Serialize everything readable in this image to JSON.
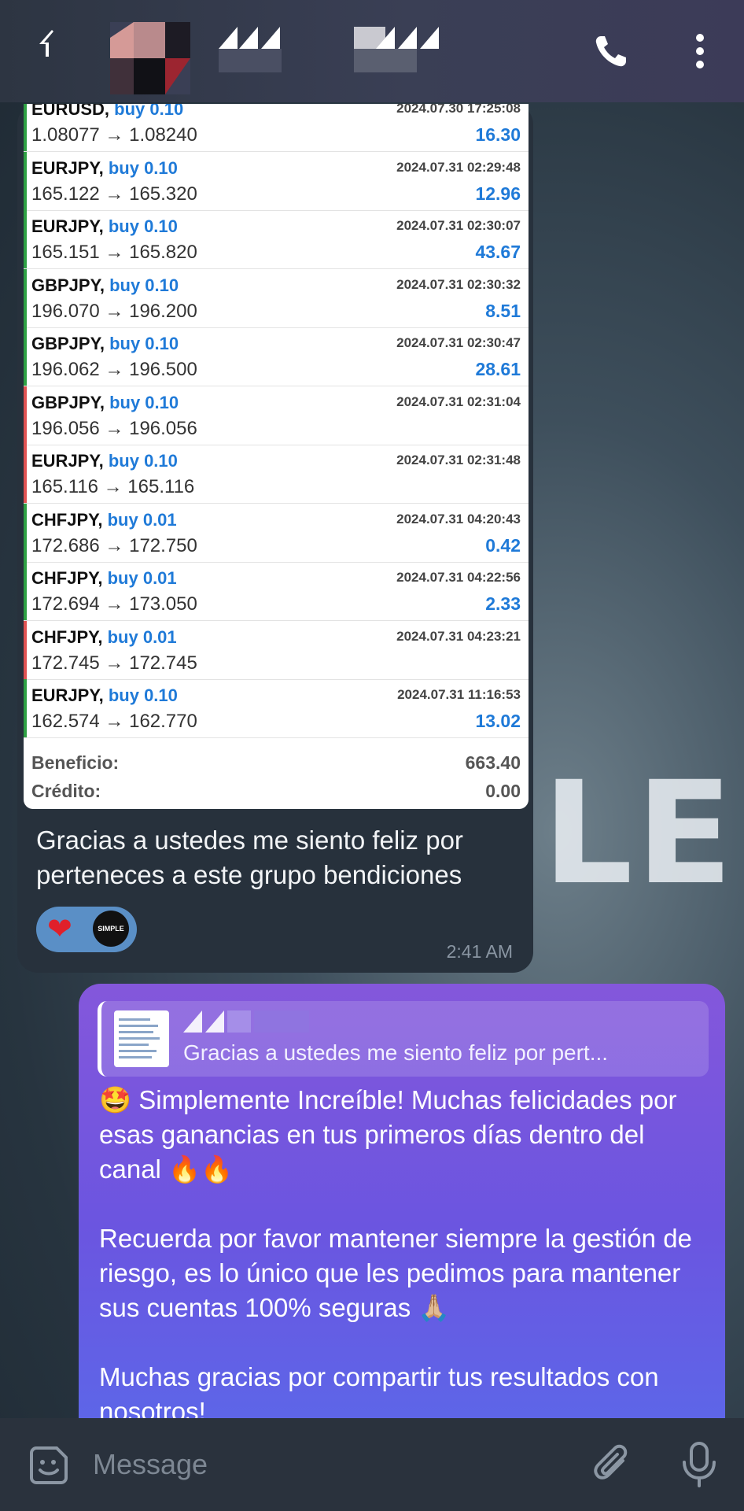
{
  "trades": [
    {
      "symbol": "EURUSD,",
      "side": "buy 0.10",
      "date": "2024.07.30 17:25:08",
      "prices": "1.08077 → 1.08240",
      "pl": "16.30",
      "color": "#2ea043"
    },
    {
      "symbol": "EURJPY,",
      "side": "buy 0.10",
      "date": "2024.07.31 02:29:48",
      "prices": "165.122 → 165.320",
      "pl": "12.96",
      "color": "#2ea043"
    },
    {
      "symbol": "EURJPY,",
      "side": "buy 0.10",
      "date": "2024.07.31 02:30:07",
      "prices": "165.151 → 165.820",
      "pl": "43.67",
      "color": "#2ea043"
    },
    {
      "symbol": "GBPJPY,",
      "side": "buy 0.10",
      "date": "2024.07.31 02:30:32",
      "prices": "196.070 → 196.200",
      "pl": "8.51",
      "color": "#2ea043"
    },
    {
      "symbol": "GBPJPY,",
      "side": "buy 0.10",
      "date": "2024.07.31 02:30:47",
      "prices": "196.062 → 196.500",
      "pl": "28.61",
      "color": "#2ea043"
    },
    {
      "symbol": "GBPJPY,",
      "side": "buy 0.10",
      "date": "2024.07.31 02:31:04",
      "prices": "196.056 → 196.056",
      "pl": "",
      "color": "#e05252"
    },
    {
      "symbol": "EURJPY,",
      "side": "buy 0.10",
      "date": "2024.07.31 02:31:48",
      "prices": "165.116 → 165.116",
      "pl": "",
      "color": "#e05252"
    },
    {
      "symbol": "CHFJPY,",
      "side": "buy 0.01",
      "date": "2024.07.31 04:20:43",
      "prices": "172.686 → 172.750",
      "pl": "0.42",
      "color": "#2ea043"
    },
    {
      "symbol": "CHFJPY,",
      "side": "buy 0.01",
      "date": "2024.07.31 04:22:56",
      "prices": "172.694 → 173.050",
      "pl": "2.33",
      "color": "#2ea043"
    },
    {
      "symbol": "CHFJPY,",
      "side": "buy 0.01",
      "date": "2024.07.31 04:23:21",
      "prices": "172.745 → 172.745",
      "pl": "",
      "color": "#e05252"
    },
    {
      "symbol": "EURJPY,",
      "side": "buy 0.10",
      "date": "2024.07.31 11:16:53",
      "prices": "162.574 → 162.770",
      "pl": "13.02",
      "color": "#2ea043"
    }
  ],
  "summary": {
    "profit_label": "Beneficio:",
    "profit_value": "663.40",
    "credit_label": "Crédito:",
    "credit_value": "0.00"
  },
  "incoming": {
    "text": "Gracias a ustedes me siento feliz por perteneces a este grupo bendiciones",
    "reaction_emoji": "❤",
    "reaction_avatar": "SIMPLE",
    "time": "2:41 AM"
  },
  "background_text": "LE",
  "outgoing": {
    "reply_text": "Gracias a ustedes me siento feliz por pert...",
    "paragraphs": [
      "🤩 Simplemente Increíble! Muchas felicidades por esas ganancias en tus primeros días dentro del canal 🔥🔥",
      "Recuerda por favor mantener siempre la gestión de riesgo, es lo único que les pedimos para mantener sus cuentas 100% seguras 🙏🏼",
      "Muchas gracias por compartir tus resultados con nosotros!"
    ]
  },
  "input": {
    "placeholder": "Message"
  },
  "icons": {
    "back": "back-arrow-icon",
    "call": "phone-icon",
    "more": "more-vertical-icon",
    "sticker": "sticker-icon",
    "attach": "paperclip-icon",
    "mic": "microphone-icon"
  }
}
